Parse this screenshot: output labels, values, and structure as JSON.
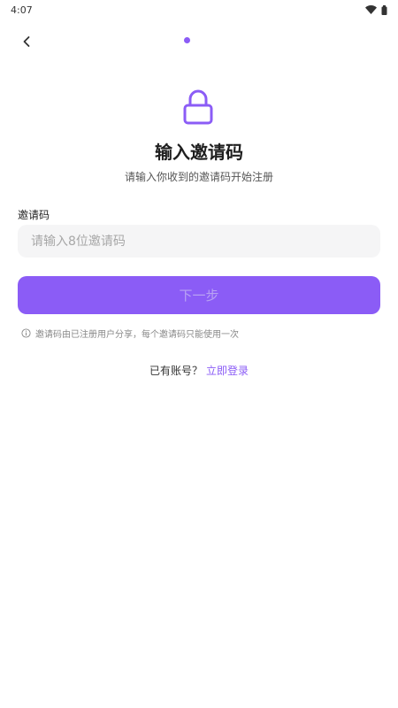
{
  "status_bar": {
    "time": "4:07",
    "icons": [
      "wifi-icon",
      "battery-icon"
    ]
  },
  "nav": {
    "back_icon": "chevron-left-icon",
    "progress_color": "#8b5cf6"
  },
  "hero": {
    "icon": "lock-icon",
    "title": "输入邀请码",
    "subtitle": "请输入你收到的邀请码开始注册"
  },
  "form": {
    "label": "邀请码",
    "input_value": "",
    "input_placeholder": "请输入8位邀请码",
    "next_label": "下一步",
    "hint_icon": "info-icon",
    "hint": "邀请码由已注册用户分享，每个邀请码只能使用一次"
  },
  "footer": {
    "prompt": "已有账号？",
    "login_link": "立即登录"
  },
  "colors": {
    "accent": "#8b5cf6",
    "input_bg": "#f5f5f6"
  }
}
